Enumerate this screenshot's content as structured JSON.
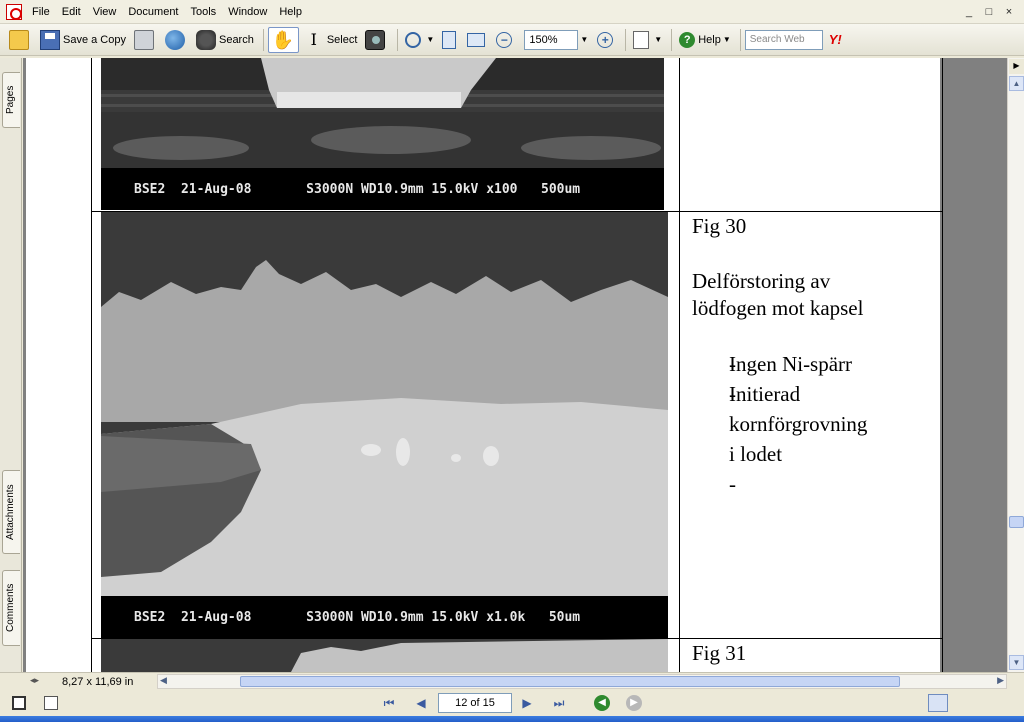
{
  "menubar": {
    "items": [
      "File",
      "Edit",
      "View",
      "Document",
      "Tools",
      "Window",
      "Help"
    ],
    "controls": [
      "_",
      "□",
      "×"
    ]
  },
  "toolbar": {
    "save_copy_label": "Save a Copy",
    "search_label": "Search",
    "select_label": "Select",
    "zoom_value": "150%",
    "help_label": "Help",
    "search_web_placeholder": "Search Web",
    "yahoo_label": "Y!"
  },
  "sidetabs": {
    "pages": "Pages",
    "attachments": "Attachments",
    "comments": "Comments"
  },
  "document": {
    "top_image_caption": "BSE2  21-Aug-08       S3000N WD10.9mm 15.0kV x100   500um",
    "fig30": {
      "label": "Fig 30",
      "title_line1": "Delförstoring av",
      "title_line2": "lödfogen mot kapsel",
      "bullets": [
        {
          "dash": "-",
          "text": "Ingen Ni-spärr"
        },
        {
          "dash": "-",
          "text": "Initierad"
        },
        {
          "dash": "",
          "text": "kornförgrovning"
        },
        {
          "dash": "",
          "text": "i lodet"
        },
        {
          "dash": "-",
          "text": ""
        }
      ],
      "image_caption": "BSE2  21-Aug-08       S3000N WD10.9mm 15.0kV x1.0k   50um"
    },
    "fig31": {
      "label": "Fig 31"
    }
  },
  "status": {
    "page_size": "8,27 x 11,69 in"
  },
  "navigation": {
    "page_indicator": "12 of 15"
  }
}
